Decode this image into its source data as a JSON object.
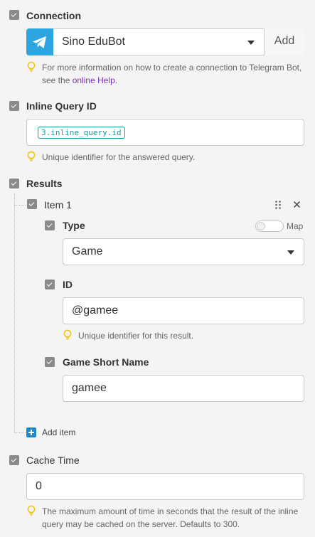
{
  "connection": {
    "label": "Connection",
    "selected": "Sino EduBot",
    "add_label": "Add",
    "hint_prefix": "For more information on how to create a connection to Telegram Bot, see the",
    "hint_link": "online Help",
    "hint_suffix": "."
  },
  "inline_query_id": {
    "label": "Inline Query ID",
    "token": "3.inline_query.id",
    "hint": "Unique identifier for the answered query."
  },
  "results": {
    "label": "Results",
    "item": {
      "label": "Item 1",
      "type": {
        "label": "Type",
        "map_label": "Map",
        "map_on": false,
        "selected": "Game"
      },
      "id": {
        "label": "ID",
        "value": "@gamee",
        "hint": "Unique identifier for this result."
      },
      "game_short_name": {
        "label": "Game Short Name",
        "value": "gamee"
      }
    },
    "add_item_label": "Add item"
  },
  "cache_time": {
    "label": "Cache Time",
    "value": "0",
    "hint": "The maximum amount of time in seconds that the result of the inline query may be cached on the server. Defaults to 300."
  },
  "colors": {
    "telegram_blue": "#2ca5e0",
    "link": "#7b2fb5",
    "token_teal": "#1a9aa8",
    "bulb_yellow": "#f5c518",
    "add_item_blue": "#1e88c9"
  }
}
